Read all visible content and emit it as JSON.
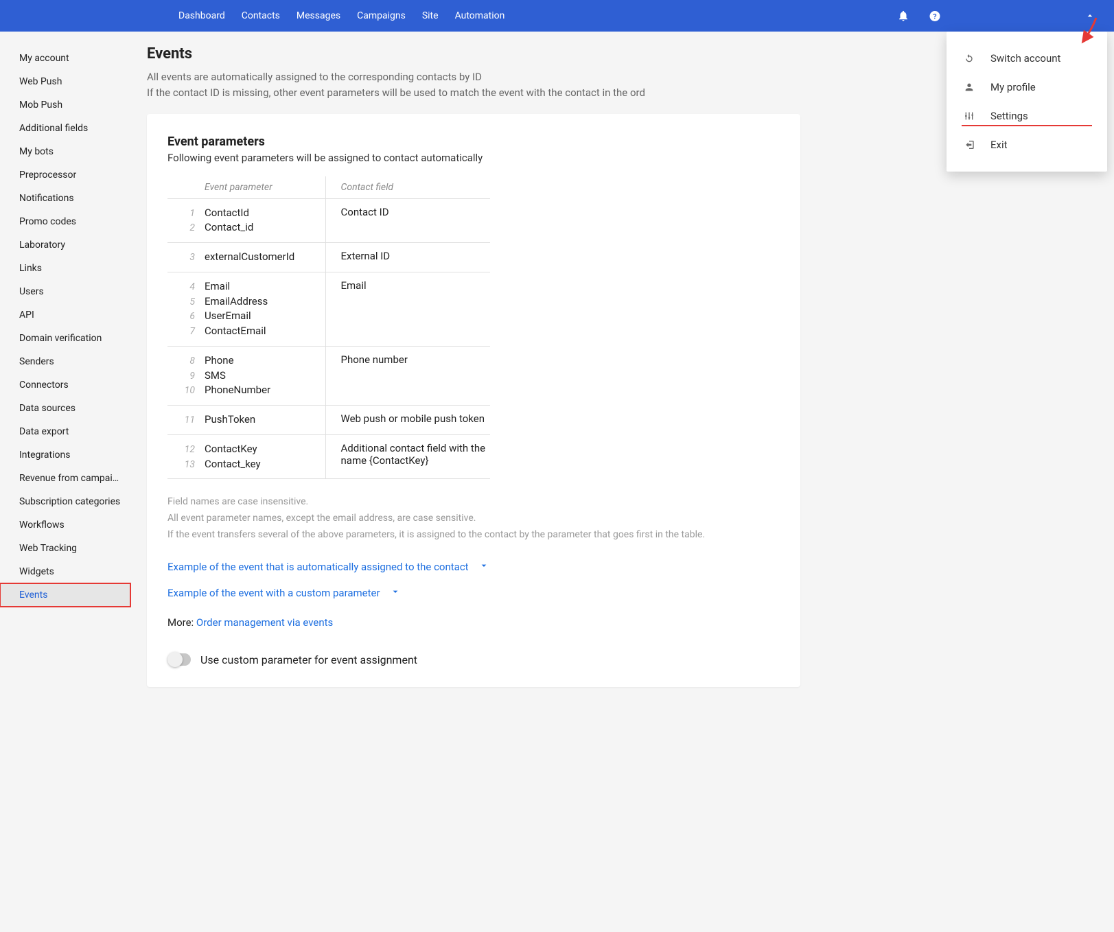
{
  "topnav": {
    "links": [
      "Dashboard",
      "Contacts",
      "Messages",
      "Campaigns",
      "Site",
      "Automation"
    ]
  },
  "dropdown": {
    "items": [
      {
        "label": "Switch account",
        "icon": "refresh-icon"
      },
      {
        "label": "My profile",
        "icon": "user-icon"
      },
      {
        "label": "Settings",
        "icon": "sliders-icon"
      },
      {
        "label": "Exit",
        "icon": "exit-icon"
      }
    ]
  },
  "sidebar": {
    "items": [
      "My account",
      "Web Push",
      "Mob Push",
      "Additional fields",
      "My bots",
      "Preprocessor",
      "Notifications",
      "Promo codes",
      "Laboratory",
      "Links",
      "Users",
      "API",
      "Domain verification",
      "Senders",
      "Connectors",
      "Data sources",
      "Data export",
      "Integrations",
      "Revenue from campaig…",
      "Subscription categories",
      "Workflows",
      "Web Tracking",
      "Widgets",
      "Events"
    ],
    "active_index": 23
  },
  "page": {
    "title": "Events",
    "desc_line1": "All events are automatically assigned to the corresponding contacts by ID",
    "desc_line2": "If the contact ID is missing, other event parameters will be used to match the event with the contact in the ord"
  },
  "card": {
    "title": "Event parameters",
    "subtitle": "Following event parameters will be assigned to contact automatically",
    "headers": {
      "event_parameter": "Event parameter",
      "contact_field": "Contact field"
    },
    "rows": [
      {
        "params": [
          "ContactId",
          "Contact_id"
        ],
        "start": 1,
        "field": "Contact ID"
      },
      {
        "params": [
          "externalCustomerId"
        ],
        "start": 3,
        "field": "External ID"
      },
      {
        "params": [
          "Email",
          "EmailAddress",
          "UserEmail",
          "ContactEmail"
        ],
        "start": 4,
        "field": "Email"
      },
      {
        "params": [
          "Phone",
          "SMS",
          "PhoneNumber"
        ],
        "start": 8,
        "field": "Phone number"
      },
      {
        "params": [
          "PushToken"
        ],
        "start": 11,
        "field": "Web push or mobile push token"
      },
      {
        "params": [
          "ContactKey",
          "Contact_key"
        ],
        "start": 12,
        "field": "Additional contact field with the name {ContactKey}"
      }
    ],
    "notes": [
      "Field names are case insensitive.",
      "All event parameter names, except the email address, are case sensitive.",
      "If the event transfers several of the above parameters, it is assigned to the contact by the parameter that goes first in the table."
    ],
    "accordion1": "Example of the event that is automatically assigned to the contact",
    "accordion2": "Example of the event with a custom parameter",
    "more_label": "More:",
    "more_link": "Order management via events",
    "toggle_label": "Use custom parameter for event assignment"
  }
}
